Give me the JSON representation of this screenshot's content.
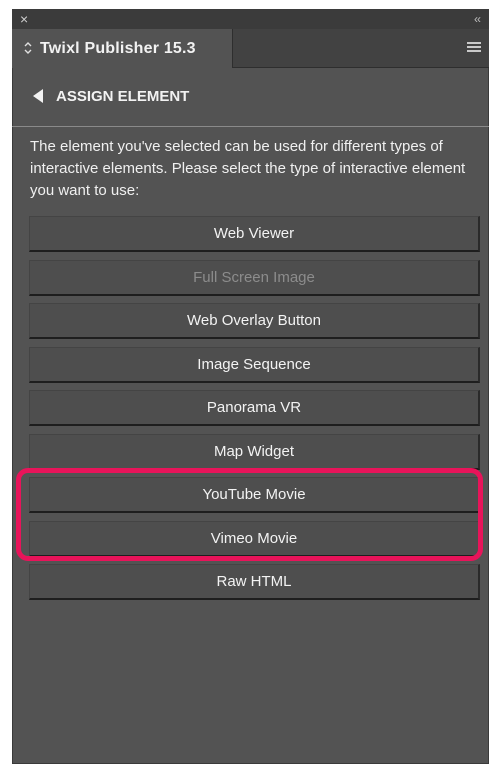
{
  "window": {
    "close_glyph": "×",
    "collapse_glyph": "‹‹"
  },
  "tab": {
    "title": "Twixl Publisher 15.3"
  },
  "section": {
    "title": "ASSIGN ELEMENT"
  },
  "description": "The element you've selected can be used for different types of interactive elements. Please select the type of interactive element you want to use:",
  "buttons": [
    {
      "label": "Web Viewer",
      "enabled": true
    },
    {
      "label": "Full Screen Image",
      "enabled": false
    },
    {
      "label": "Web Overlay Button",
      "enabled": true
    },
    {
      "label": "Image Sequence",
      "enabled": true
    },
    {
      "label": "Panorama VR",
      "enabled": true
    },
    {
      "label": "Map Widget",
      "enabled": true
    },
    {
      "label": "YouTube Movie",
      "enabled": true
    },
    {
      "label": "Vimeo Movie",
      "enabled": true
    },
    {
      "label": "Raw HTML",
      "enabled": true
    }
  ],
  "colors": {
    "panel_bg": "#535353",
    "highlight": "#e8145a",
    "disabled_text": "#8c8c8c"
  },
  "icons": {
    "close": "close-icon",
    "collapse": "double-chevron-left-icon",
    "tab_switcher": "up-down-chevron-icon",
    "menu": "hamburger-menu-icon",
    "back": "triangle-left-icon"
  }
}
